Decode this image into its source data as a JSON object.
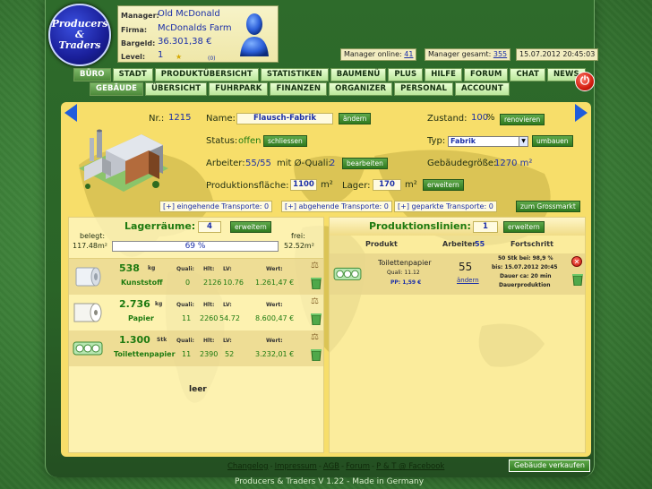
{
  "logo": {
    "line1": "Producers",
    "line2": "&",
    "line3": "Traders"
  },
  "manager": {
    "manager_label": "Manager:",
    "manager_value": "Old McDonald",
    "firma_label": "Firma:",
    "firma_value": "McDonalds Farm",
    "bargeld_label": "Bargeld:",
    "bargeld_value": "36.301,38 €",
    "level_label": "Level:",
    "level_value": "1",
    "level_points": "(0)"
  },
  "status": {
    "online_label": "Manager online:",
    "online_value": "41",
    "gesamt_label": "Manager gesamt:",
    "gesamt_value": "355",
    "datetime": "15.07.2012 20:45:03"
  },
  "nav_main": [
    {
      "label": "BÜRO",
      "active": true
    },
    {
      "label": "STADT",
      "active": false
    },
    {
      "label": "PRODUKTÜBERSICHT",
      "active": false
    },
    {
      "label": "STATISTIKEN",
      "active": false
    },
    {
      "label": "BAUMENÜ",
      "active": false
    },
    {
      "label": "PLUS",
      "active": false
    },
    {
      "label": "HILFE",
      "active": false
    },
    {
      "label": "FORUM",
      "active": false
    },
    {
      "label": "CHAT",
      "active": false
    },
    {
      "label": "NEWS",
      "active": false
    }
  ],
  "nav_sub": [
    {
      "label": "GEBÄUDE",
      "active": true
    },
    {
      "label": "ÜBERSICHT",
      "active": false
    },
    {
      "label": "FUHRPARK",
      "active": false
    },
    {
      "label": "FINANZEN",
      "active": false
    },
    {
      "label": "ORGANIZER",
      "active": false
    },
    {
      "label": "PERSONAL",
      "active": false
    },
    {
      "label": "ACCOUNT",
      "active": false
    }
  ],
  "building": {
    "nr_label": "Nr.:",
    "nr_value": "1215",
    "name_label": "Name:",
    "name_value": "Flausch-Fabrik",
    "name_btn": "ändern",
    "zustand_label": "Zustand:",
    "zustand_value": "100",
    "zustand_unit": "%",
    "zustand_btn": "renovieren",
    "status_label": "Status:",
    "status_value": "offen",
    "status_btn": "schliessen",
    "typ_label": "Typ:",
    "typ_value": "Fabrik",
    "typ_btn": "umbauen",
    "arbeiter_label": "Arbeiter:",
    "arbeiter_value": "55/55",
    "quali_label": "mit Ø-Quali:",
    "quali_value": "2",
    "arbeiter_btn": "bearbeiten",
    "groesse_label": "Gebäudegröße:",
    "groesse_value": "1270 m²",
    "flaeche_label": "Produktionsfläche:",
    "flaeche_value": "1100",
    "flaeche_unit": "m²",
    "lager_label": "Lager:",
    "lager_value": "170",
    "lager_unit": "m²",
    "lager_btn": "erweitern"
  },
  "transports": {
    "in": "[+] eingehende Transporte: 0",
    "out": "[+] abgehende Transporte: 0",
    "parked": "[+] geparkte Transporte: 0",
    "market_btn": "zum Grossmarkt"
  },
  "storage": {
    "title": "Lagerräume:",
    "count": "4",
    "expand_btn": "erweitern",
    "used_label": "belegt:",
    "used_value": "117.48m²",
    "free_label": "frei:",
    "free_value": "52.52m²",
    "percent_text": "69 %",
    "percent_fraction": 0.69,
    "hdr_quali": "Quali:",
    "hdr_hlt": "Hlt:",
    "hdr_lv": "LV:",
    "hdr_wert": "Wert:",
    "items": [
      {
        "amount": "538",
        "unit": "kg",
        "name": "Kunststoff",
        "quali": "0",
        "hlt": "2126",
        "lv": "10.76",
        "wert": "1.261,47 €",
        "icon": "plastic-roll-icon"
      },
      {
        "amount": "2.736",
        "unit": "kg",
        "name": "Papier",
        "quali": "11",
        "hlt": "2260",
        "lv": "54.72",
        "wert": "8.600,47 €",
        "icon": "paper-roll-icon"
      },
      {
        "amount": "1.300",
        "unit": "Stk",
        "name": "Toilettenpapier",
        "quali": "11",
        "hlt": "2390",
        "lv": "52",
        "wert": "3.232,01 €",
        "icon": "toilet-paper-pack-icon"
      }
    ],
    "empty_label": "leer"
  },
  "production": {
    "title": "Produktionslinien:",
    "count": "1",
    "expand_btn": "erweitern",
    "col_produkt": "Produkt",
    "col_arbeiter": "Arbeiter",
    "col_arbeiter_value": "55",
    "col_fortschritt": "Fortschritt",
    "line": {
      "product": "Toilettenpapier",
      "quali": "Quali: 11.12",
      "pp": "PP: 1,59 €",
      "workers": "55",
      "workers_btn": "ändern",
      "progress1": "50 Stk bei: 98,9 %",
      "progress2": "bis: 15.07.2012 20:45",
      "progress3": "Dauer ca: 20 min",
      "progress4": "Dauerproduktion"
    }
  },
  "footer": {
    "links": [
      "Changelog",
      "Impressum",
      "AGB",
      "Forum",
      "P & T @ Facebook"
    ],
    "copyright": "Producers & Traders V 1.22 - Made in Germany",
    "sell_btn": "Gebäude verkaufen"
  }
}
